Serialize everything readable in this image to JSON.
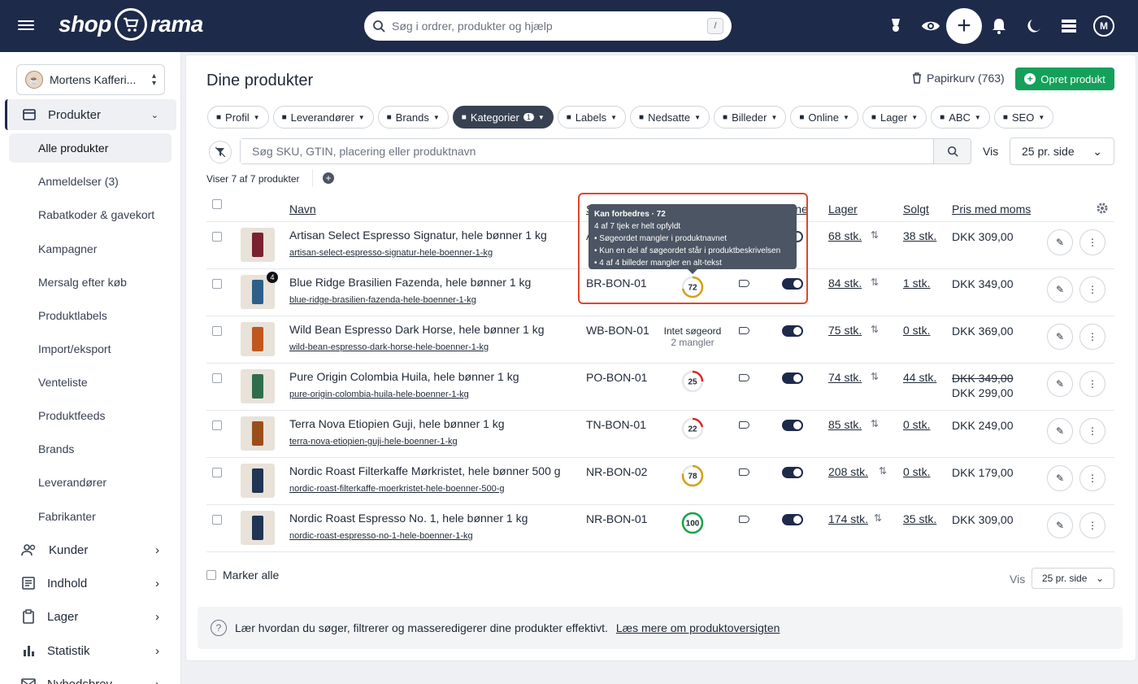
{
  "topbar": {
    "logo_left": "shop",
    "logo_right": "rama",
    "search_placeholder": "Søg i ordrer, produkter og hjælp",
    "search_shortcut": "/",
    "avatar_initial": "M"
  },
  "sidebar": {
    "store_name": "Mortens Kafferi...",
    "products_label": "Produkter",
    "sub_items": [
      "Alle produkter",
      "Anmeldelser (3)",
      "Rabatkoder & gavekort",
      "Kampagner",
      "Mersalg efter køb",
      "Produktlabels",
      "Import/eksport",
      "Venteliste",
      "Produktfeeds",
      "Brands",
      "Leverandører",
      "Fabrikanter"
    ],
    "sections": [
      "Kunder",
      "Indhold",
      "Lager",
      "Statistik",
      "Nyhedsbrev"
    ]
  },
  "page": {
    "title": "Dine produkter",
    "trash_label": "Papirkurv (763)",
    "create_label": "Opret produkt",
    "filters": [
      {
        "label": "Profil",
        "icon": "profile-icon"
      },
      {
        "label": "Leverandører",
        "icon": "truck-icon"
      },
      {
        "label": "Brands",
        "icon": "tag-icon"
      },
      {
        "label": "Kategorier",
        "icon": "folder-icon",
        "count": "1",
        "active": true
      },
      {
        "label": "Labels",
        "icon": "label-icon"
      },
      {
        "label": "Nedsatte",
        "icon": "discount-icon"
      },
      {
        "label": "Billeder",
        "icon": "image-icon"
      },
      {
        "label": "Online",
        "icon": "globe-icon"
      },
      {
        "label": "Lager",
        "icon": "warehouse-icon"
      },
      {
        "label": "ABC",
        "icon": "abc-icon"
      },
      {
        "label": "SEO",
        "icon": "seo-icon"
      }
    ],
    "sku_placeholder": "Søg SKU, GTIN, placering eller produktnavn",
    "vis_label": "Vis",
    "per_page": "25 pr. side",
    "count_text": "Viser 7 af 7 produkter"
  },
  "table": {
    "headers": {
      "name": "Navn",
      "sku": "S",
      "online": "line",
      "stock": "Lager",
      "sold": "Solgt",
      "price": "Pris med moms"
    },
    "rows": [
      {
        "name": "Artisan Select Espresso Signatur, hele bønner 1 kg",
        "slug": "artisan-select-espresso-signatur-hele-boenner-1-kg",
        "sku": "A",
        "seo": null,
        "stock": "68 stk.",
        "sold": "38 stk.",
        "price": "DKK 309,00",
        "old_price": null,
        "color": "#7a2230",
        "badge": null
      },
      {
        "name": "Blue Ridge Brasilien Fazenda, hele bønner 1 kg",
        "slug": "blue-ridge-brasilien-fazenda-hele-boenner-1-kg",
        "sku": "BR-BON-01",
        "seo": 72,
        "stock": "84 stk.",
        "sold": "1 stk.",
        "price": "DKK 349,00",
        "old_price": null,
        "color": "#2d5f8a",
        "badge": "4"
      },
      {
        "name": "Wild Bean Espresso Dark Horse, hele bønner 1 kg",
        "slug": "wild-bean-espresso-dark-horse-hele-boenner-1-kg",
        "sku": "WB-BON-01",
        "seo": null,
        "seo_text1": "Intet søgeord",
        "seo_text2": "2 mangler",
        "stock": "75 stk.",
        "sold": "0 stk.",
        "price": "DKK 369,00",
        "old_price": null,
        "color": "#c0571f",
        "badge": null
      },
      {
        "name": "Pure Origin Colombia Huila, hele bønner 1 kg",
        "slug": "pure-origin-colombia-huila-hele-boenner-1-kg",
        "sku": "PO-BON-01",
        "seo": 25,
        "stock": "74 stk.",
        "sold": "44 stk.",
        "price": "DKK 299,00",
        "old_price": "DKK 349,00",
        "color": "#2f6e4a",
        "badge": null
      },
      {
        "name": "Terra Nova Etiopien Guji, hele bønner 1 kg",
        "slug": "terra-nova-etiopien-guji-hele-boenner-1-kg",
        "sku": "TN-BON-01",
        "seo": 22,
        "stock": "85 stk.",
        "sold": "0 stk.",
        "price": "DKK 249,00",
        "old_price": null,
        "color": "#9a4f1a",
        "badge": null
      },
      {
        "name": "Nordic Roast Filterkaffe Mørkristet, hele bønner 500 g",
        "slug": "nordic-roast-filterkaffe-moerkristet-hele-boenner-500-g",
        "sku": "NR-BON-02",
        "seo": 78,
        "stock": "208 stk.",
        "sold": "0 stk.",
        "price": "DKK 179,00",
        "old_price": null,
        "color": "#1f3553",
        "badge": null
      },
      {
        "name": "Nordic Roast Espresso No. 1, hele bønner 1 kg",
        "slug": "nordic-roast-espresso-no-1-hele-boenner-1-kg",
        "sku": "NR-BON-01",
        "seo": 100,
        "stock": "174 stk.",
        "sold": "35 stk.",
        "price": "DKK 309,00",
        "old_price": null,
        "color": "#1f3553",
        "badge": null
      }
    ]
  },
  "tooltip": {
    "title": "Kan forbedres · 72",
    "line1": "4 af 7 tjek er helt opfyldt",
    "line2": "• Søgeordet mangler i produktnavnet",
    "line3": "• Kun en del af søgeordet står i produktbeskrivelsen",
    "line4": "• 4 af 4 billeder mangler en alt-tekst"
  },
  "footer": {
    "mark_all": "Marker alle",
    "vis_label": "Vis",
    "per_page": "25 pr. side",
    "help_text": "Lær hvordan du søger, filtrerer og masseredigerer dine produkter effektivt.",
    "help_link": "Læs mere om produktoversigten"
  },
  "colors": {
    "navy": "#1e2a4a",
    "green": "#14a05a",
    "alert": "#e0452b"
  }
}
